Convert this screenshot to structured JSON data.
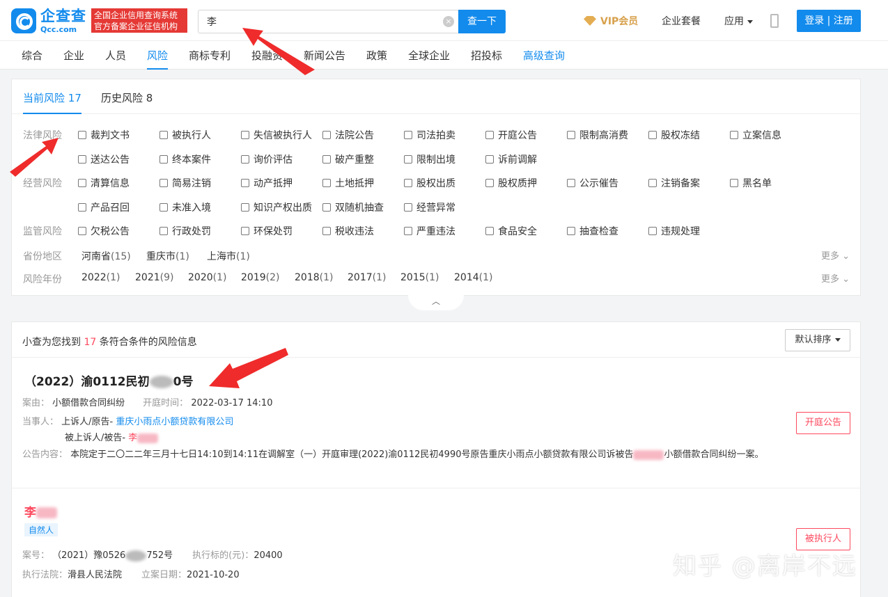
{
  "header": {
    "logo_cn": "企查查",
    "logo_en": "Qcc.com",
    "badge_line1": "全国企业信用查询系统",
    "badge_line2": "官方备案企业征信机构",
    "search_value": "李",
    "search_button": "查一下",
    "vip": "VIP会员",
    "enterprise_package": "企业套餐",
    "apps": "应用",
    "login": "登录 | 注册"
  },
  "nav": [
    "综合",
    "企业",
    "人员",
    "风险",
    "商标专利",
    "投融资",
    "新闻公告",
    "政策",
    "全球企业",
    "招投标",
    "高级查询"
  ],
  "filter": {
    "tab_current": "当前风险",
    "tab_current_count": "17",
    "tab_history": "历史风险",
    "tab_history_count": "8",
    "groups": [
      {
        "label": "法律风险",
        "rows": [
          [
            "裁判文书",
            "被执行人",
            "失信被执行人",
            "法院公告",
            "司法拍卖",
            "开庭公告",
            "限制高消费",
            "股权冻结",
            "立案信息"
          ],
          [
            "送达公告",
            "终本案件",
            "询价评估",
            "破产重整",
            "限制出境",
            "诉前调解"
          ]
        ]
      },
      {
        "label": "经营风险",
        "rows": [
          [
            "清算信息",
            "简易注销",
            "动产抵押",
            "土地抵押",
            "股权出质",
            "股权质押",
            "公示催告",
            "注销备案",
            "黑名单"
          ],
          [
            "产品召回",
            "未准入境",
            "知识产权出质",
            "双随机抽查",
            "经营异常"
          ]
        ]
      },
      {
        "label": "监管风险",
        "rows": [
          [
            "欠税公告",
            "行政处罚",
            "环保处罚",
            "税收违法",
            "严重违法",
            "食品安全",
            "抽查检查",
            "违规处理"
          ]
        ]
      }
    ],
    "region_label": "省份地区",
    "regions": [
      {
        "name": "河南省",
        "count": "(15)"
      },
      {
        "name": "重庆市",
        "count": "(1)"
      },
      {
        "name": "上海市",
        "count": "(1)"
      }
    ],
    "year_label": "风险年份",
    "years": [
      {
        "name": "2022",
        "count": "(1)"
      },
      {
        "name": "2021",
        "count": "(9)"
      },
      {
        "name": "2020",
        "count": "(1)"
      },
      {
        "name": "2019",
        "count": "(2)"
      },
      {
        "name": "2018",
        "count": "(1)"
      },
      {
        "name": "2017",
        "count": "(1)"
      },
      {
        "name": "2015",
        "count": "(1)"
      },
      {
        "name": "2014",
        "count": "(1)"
      }
    ],
    "more": "更多"
  },
  "results": {
    "prefix": "小查为您找到 ",
    "count": "17",
    "suffix": " 条符合条件的风险信息",
    "sort": "默认排序",
    "item1": {
      "case_no_a": "（2022）渝0112民初",
      "case_no_b": "0号",
      "cause_label": "案由：",
      "cause": "小额借款合同纠纷",
      "time_label": "开庭时间：",
      "time": "2022-03-17 14:10",
      "party_label": "当事人：",
      "plaintiff_role": "上诉人/原告-",
      "plaintiff": "重庆小雨点小额贷款有限公司",
      "defendant_role": "被上诉人/被告-",
      "defendant": "李",
      "tag": "开庭公告",
      "content_label": "公告内容：",
      "content_a": "本院定于二〇二二年三月十七日14:10到14:11在调解室（一）开庭审理(2022)渝0112民初4990号原告重庆小雨点小额贷款有限公司诉被告",
      "content_b": "小额借款合同纠纷一案。"
    },
    "item2": {
      "name": "李",
      "person_tag": "自然人",
      "case_label": "案号：",
      "case_no_a": "（2021）豫0526",
      "case_no_b": "752号",
      "amount_label": "执行标的(元)：",
      "amount": "20400",
      "court_label": "执行法院：",
      "court": "滑县人民法院",
      "date_label": "立案日期：",
      "date": "2021-10-20",
      "tag": "被执行人"
    }
  },
  "watermark": "知乎 @离岸不远"
}
